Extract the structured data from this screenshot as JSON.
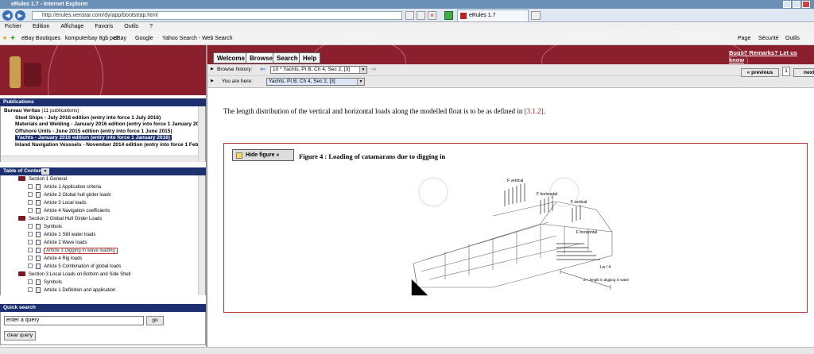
{
  "window": {
    "title": "eRules 1.7 - Internet Explorer"
  },
  "address": {
    "url": "http://erules.veristar.com/dy/app/bootstrap.html",
    "tab_label": "eRules 1.7"
  },
  "menu": [
    "Fichier",
    "Edition",
    "Affichage",
    "Favoris",
    "Outils",
    "?"
  ],
  "favorites": [
    "eBay Boutiques",
    "komputerbay 8gb pc2",
    "eBay",
    "Google",
    "Yahoo Search - Web Search"
  ],
  "commandbar": {
    "page": "Page",
    "security": "Sécurité",
    "tools": "Outils"
  },
  "publications": {
    "header": "Publications",
    "root": "Bureau Veritas",
    "count": "(11 publications)",
    "items": [
      "Steel Ships - July 2016 edition (entry into force 1 July 2016)",
      "Materials and Welding - January 2016 edition (entry into force 1 January 201",
      "Offshore Units - June 2015 edition (entry into force 1 June 2015)",
      "Yachts - January 2016 edition (entry into force 1 January 2016)",
      "Inland Navigation Vesssels - November 2014 edition (entry into force 1 Febr"
    ]
  },
  "toc": {
    "header": "Table of Contents",
    "items": [
      "Section 1 General",
      "Article 1 Application criteria",
      "Article 2 Global hull girder loads",
      "Article 3 Local loads",
      "Article 4 Navigation coefficients",
      "Section 2 Global Hull Girder Loads",
      "Symbols",
      "Article 1 Still water loads",
      "Article 2 Wave loads",
      "Article 3 Digging in wave loading",
      "Article 4 Rig loads",
      "Article 5 Combination of global loads",
      "Section 3 Local Loads on Bottom and Side Shell",
      "Symbols",
      "Article 1 Definition and application"
    ]
  },
  "quick_search": {
    "header": "Quick search",
    "value": "enter a query",
    "go": "go",
    "clear": "clear query"
  },
  "tabs": [
    "Welcome",
    "Browse",
    "Search",
    "Help"
  ],
  "bugs_link": "Bugs? Remarks? Let us know",
  "history": {
    "label": "Browse history:",
    "value": "10 * Yachts, Pt B, Ch 4, Sec 2, [3]"
  },
  "here": {
    "label": "You are here:",
    "value": "Yachts, Pt B, Ch 4, Sec 2, [3]"
  },
  "pager": {
    "previous": "« previous",
    "page": "1",
    "next": "next"
  },
  "content": {
    "text_before": "The length distribution of the vertical and horizontal loads along the modelled float is to be as defined in",
    "ref": "[3.1.2]",
    "text_after": "."
  },
  "figure": {
    "hide_label": "Hide figure «",
    "caption": "Figure 4 : Loading of catamarans due to digging in",
    "labels": {
      "fv1": "F vertical",
      "fh1": "F horizontal",
      "fv2": "F vertical",
      "fh2": "F horizontal",
      "len": "Lw / 4",
      "dig": "d = length in digging in water"
    }
  },
  "colors": {
    "brand": "#8c1f2e",
    "navy": "#1c2f6e"
  }
}
